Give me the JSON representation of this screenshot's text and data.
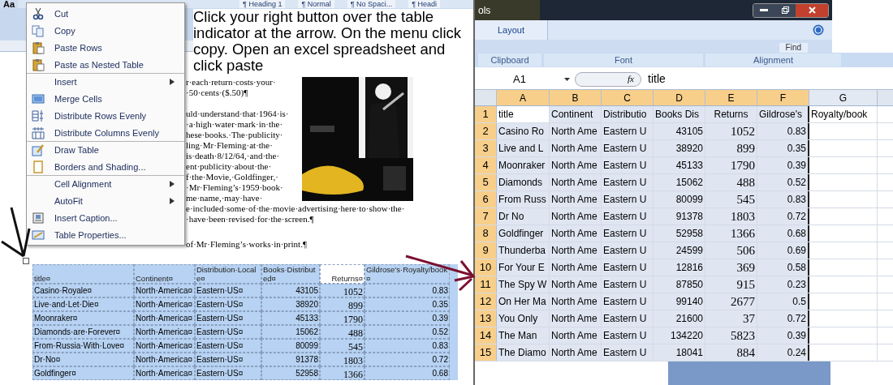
{
  "word": {
    "theme_button": "Aa",
    "style_gallery": [
      "¶ Heading 1",
      "¶ Normal",
      "¶ No Spaci...",
      "¶ Headi"
    ],
    "context_menu": {
      "items": [
        {
          "label": "Cut",
          "submenu": false,
          "separator_before": false
        },
        {
          "label": "Copy",
          "submenu": false,
          "separator_before": false
        },
        {
          "label": "Paste Rows",
          "submenu": false,
          "separator_before": false
        },
        {
          "label": "Paste as Nested Table",
          "submenu": false,
          "separator_before": false
        },
        {
          "label": "Insert",
          "submenu": true,
          "separator_before": true
        },
        {
          "label": "Merge Cells",
          "submenu": false,
          "separator_before": false
        },
        {
          "label": "Distribute Rows Evenly",
          "submenu": false,
          "separator_before": false
        },
        {
          "label": "Distribute Columns Evenly",
          "submenu": false,
          "separator_before": false
        },
        {
          "label": "Draw Table",
          "submenu": false,
          "separator_before": true
        },
        {
          "label": "Borders and Shading...",
          "submenu": false,
          "separator_before": false
        },
        {
          "label": "Cell Alignment",
          "submenu": true,
          "separator_before": true
        },
        {
          "label": "AutoFit",
          "submenu": true,
          "separator_before": false
        },
        {
          "label": "Insert Caption...",
          "submenu": false,
          "separator_before": false
        },
        {
          "label": "Table Properties...",
          "submenu": false,
          "separator_before": false
        }
      ]
    },
    "callout": "Click your right button over the table indicator at the arrow. On the menu click copy. Open an excel spreadsheet and click paste",
    "body_beside_picture": [
      [
        "r·each·return·costs·your·",
        "·50·cents·($.50)¶"
      ],
      [
        "uld·understand·that·1964·is·",
        "·a·high·water·mark·in·the·",
        "hese·books.·The·publicity·",
        "ling·Mr·Fleming·at·the·",
        "is·death·8/12/64,·and·the·",
        "ent·publicity·about·the·",
        "f·the·Movie,·Goldfinger,·",
        "·Mr·Fleming’s·1959·book·",
        "me·name,·may·have·"
      ]
    ],
    "body_below": [
      [
        "e·included·some·of·the·movie·advertising·here·to·show·the·",
        "·have·been·revised·for·the·screen.¶"
      ],
      [
        "of·Mr·Fleming’s·works·in·print.¶"
      ]
    ],
    "table": {
      "columns": [
        "title¤",
        "Continent¤",
        "Distribution·Locale¤",
        "Books·Distributed¤",
        "Returns¤",
        "Gildrose’s·Royalty/book¤"
      ],
      "rows": [
        [
          "Casino·Royale¤",
          "North·America¤",
          "Eastern·US¤",
          "43105",
          "1052",
          "0.83"
        ],
        [
          "Live·and·Let·Die¤",
          "North·America¤",
          "Eastern·US¤",
          "38920",
          "899",
          "0.35"
        ],
        [
          "Moonraker¤",
          "North·America¤",
          "Eastern·US¤",
          "45133",
          "1790",
          "0.39"
        ],
        [
          "Diamonds·are·Forever¤",
          "North·America¤",
          "Eastern·US¤",
          "15062",
          "488",
          "0.52"
        ],
        [
          "From·Russia·With·Love¤",
          "North·America¤",
          "Eastern·US¤",
          "80099",
          "545",
          "0.83"
        ],
        [
          "Dr·No¤",
          "North·America¤",
          "Eastern·US¤",
          "91378",
          "1803",
          "0.72"
        ],
        [
          "Goldfinger¤",
          "North·America¤",
          "Eastern·US¤",
          "52958",
          "1366",
          "0.68"
        ]
      ]
    }
  },
  "excel": {
    "tab_fragment": "ols",
    "tabs": [
      {
        "label": "Layout",
        "selected": true
      }
    ],
    "find_button": "Find",
    "groups": [
      "Clipboard",
      "Font",
      "Alignment"
    ],
    "name_box": "A1",
    "function_label": "fx",
    "formula": "title",
    "columns": [
      {
        "label": "A",
        "selected": true
      },
      {
        "label": "B",
        "selected": true
      },
      {
        "label": "C",
        "selected": true
      },
      {
        "label": "D",
        "selected": true
      },
      {
        "label": "E",
        "selected": true
      },
      {
        "label": "F",
        "selected": true
      },
      {
        "label": "G",
        "selected": false
      }
    ],
    "rows": [
      {
        "number": "1",
        "selected": true,
        "cells": [
          "title",
          "Continent",
          "Distributio",
          "Books Dis",
          "Returns",
          "Gildrose's",
          "Royalty/book"
        ]
      },
      {
        "number": "2",
        "selected": true,
        "cells": [
          "Casino Ro",
          "North Ame",
          "Eastern U",
          "43105",
          "1052",
          "0.83",
          ""
        ]
      },
      {
        "number": "3",
        "selected": true,
        "cells": [
          "Live and L",
          "North Ame",
          "Eastern U",
          "38920",
          "899",
          "0.35",
          ""
        ]
      },
      {
        "number": "4",
        "selected": true,
        "cells": [
          "Moonraker",
          "North Ame",
          "Eastern U",
          "45133",
          "1790",
          "0.39",
          ""
        ]
      },
      {
        "number": "5",
        "selected": true,
        "cells": [
          "Diamonds",
          "North Ame",
          "Eastern U",
          "15062",
          "488",
          "0.52",
          ""
        ]
      },
      {
        "number": "6",
        "selected": true,
        "cells": [
          "From Russ",
          "North Ame",
          "Eastern U",
          "80099",
          "545",
          "0.83",
          ""
        ]
      },
      {
        "number": "7",
        "selected": true,
        "cells": [
          "Dr No",
          "North Ame",
          "Eastern U",
          "91378",
          "1803",
          "0.72",
          ""
        ]
      },
      {
        "number": "8",
        "selected": true,
        "cells": [
          "Goldfinger",
          "North Ame",
          "Eastern U",
          "52958",
          "1366",
          "0.68",
          ""
        ]
      },
      {
        "number": "9",
        "selected": true,
        "cells": [
          "Thunderba",
          "North Ame",
          "Eastern U",
          "24599",
          "506",
          "0.69",
          ""
        ]
      },
      {
        "number": "10",
        "selected": true,
        "cells": [
          "For Your E",
          "North Ame",
          "Eastern U",
          "12816",
          "369",
          "0.58",
          ""
        ]
      },
      {
        "number": "11",
        "selected": true,
        "cells": [
          "The Spy W",
          "North Ame",
          "Eastern U",
          "87850",
          "915",
          "0.23",
          ""
        ]
      },
      {
        "number": "12",
        "selected": true,
        "cells": [
          "On Her Ma",
          "North Ame",
          "Eastern U",
          "99140",
          "2677",
          "0.5",
          ""
        ]
      },
      {
        "number": "13",
        "selected": true,
        "cells": [
          "You Only",
          "North Ame",
          "Eastern U",
          "21600",
          "37",
          "0.72",
          ""
        ]
      },
      {
        "number": "14",
        "selected": true,
        "cells": [
          "The Man",
          "North Ame",
          "Eastern U",
          "134220",
          "5823",
          "0.39",
          ""
        ]
      },
      {
        "number": "15",
        "selected": true,
        "cells": [
          "The Diamo",
          "North Ame",
          "Eastern U",
          "18041",
          "884",
          "0.24",
          ""
        ]
      }
    ]
  }
}
